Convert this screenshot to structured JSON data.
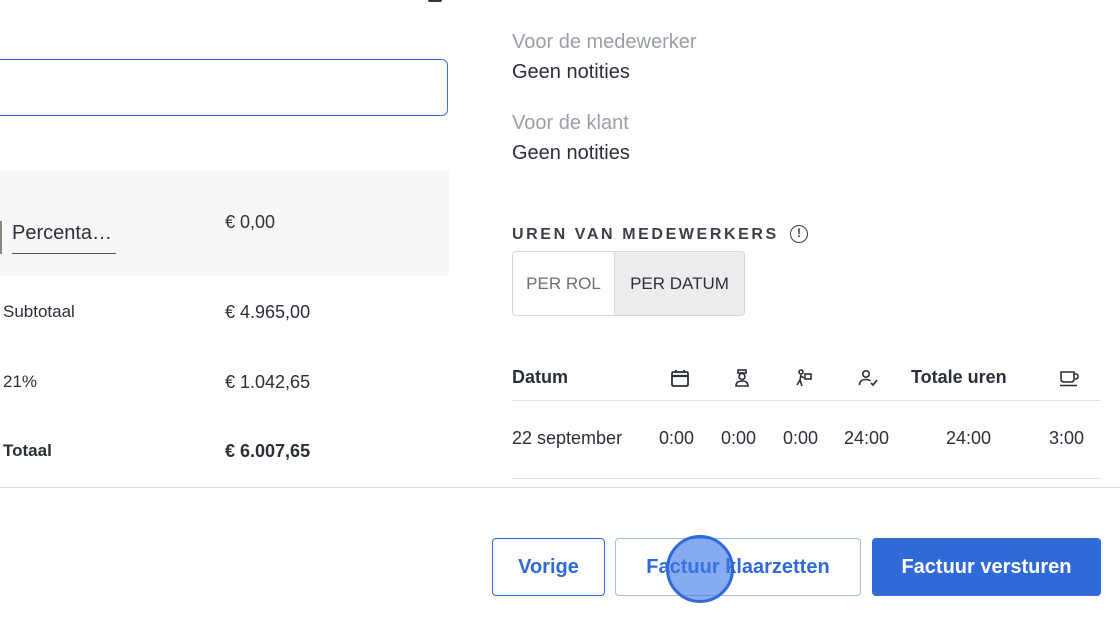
{
  "left": {
    "discount": {
      "type_select": "Percenta…",
      "value": "€ 0,00"
    },
    "rows": [
      {
        "label": "Subtotaal",
        "value": "€ 4.965,00"
      },
      {
        "label": "21%",
        "value": "€ 1.042,65"
      },
      {
        "label": "Totaal",
        "value": "€ 6.007,65"
      }
    ]
  },
  "notes": {
    "employee_title": "Voor de medewerker",
    "employee_value": "Geen notities",
    "client_title": "Voor de klant",
    "client_value": "Geen notities"
  },
  "hours": {
    "section_title": "UREN VAN MEDEWERKERS",
    "info_glyph": "!",
    "tabs": {
      "per_role": "PER ROL",
      "per_date": "PER DATUM",
      "active": "per_date"
    },
    "columns": {
      "date": "Datum",
      "icon_1": "calendar-icon",
      "icon_2": "worker-icon",
      "icon_3": "travel-icon",
      "icon_4": "user-check-icon",
      "total": "Totale uren",
      "icon_5": "coffee-break-icon"
    },
    "rows": [
      {
        "date": "22 september",
        "c1": "0:00",
        "c2": "0:00",
        "c3": "0:00",
        "c4": "24:00",
        "total": "24:00",
        "break": "3:00"
      }
    ]
  },
  "footer": {
    "prev_label": "Vorige",
    "ready_label": "Factuur klaarzetten",
    "send_label": "Factuur versturen"
  },
  "colors": {
    "accent": "#2f6ad6",
    "muted_text": "#9a9ea6",
    "panel_bg": "#f7f7f8"
  }
}
